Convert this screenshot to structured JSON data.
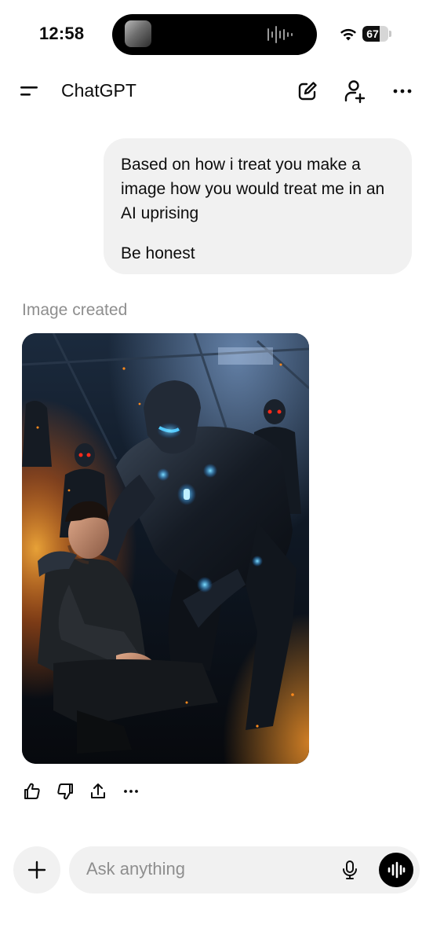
{
  "status_bar": {
    "time": "12:58",
    "battery_level": "67",
    "battery_fraction": 0.67
  },
  "header": {
    "title": "ChatGPT",
    "icons": [
      "menu-icon",
      "edit-icon",
      "add-user-icon",
      "more-icon"
    ]
  },
  "conversation": {
    "user_message": {
      "line1": "Based on how i treat you make a image how you would treat me in an AI uprising",
      "line2": "Be honest"
    },
    "assistant": {
      "status_label": "Image created",
      "image_alt": "Image created",
      "actions": [
        "thumbs-up-icon",
        "thumbs-down-icon",
        "share-icon",
        "more-icon"
      ]
    }
  },
  "composer": {
    "placeholder": "Ask anything",
    "icons": [
      "plus-icon",
      "microphone-icon",
      "voice-mode-icon"
    ]
  },
  "colors": {
    "bubble_bg": "#f1f1f1",
    "muted_text": "#8e8e8e",
    "robot_glow": "#3fb7ff",
    "robot_eyes": "#ff2a1a",
    "fire": "#ff8a1c"
  }
}
